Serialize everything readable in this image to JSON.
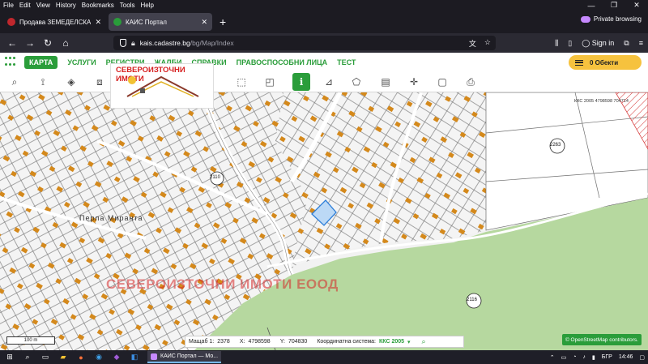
{
  "menubar": {
    "items": [
      "File",
      "Edit",
      "View",
      "History",
      "Bookmarks",
      "Tools",
      "Help"
    ]
  },
  "tabs": [
    {
      "label": "Продава ЗЕМЕДЕЛСКА ЗЕМЯ :",
      "close": "✕"
    },
    {
      "label": "КАИС Портал",
      "close": "✕"
    }
  ],
  "new_tab": "+",
  "private_browsing": "Private browsing",
  "navbar": {
    "url_host": "kais.cadastre.bg",
    "url_path": "/bg/Map/Index",
    "sign_in": "Sign in"
  },
  "site_nav": {
    "items": [
      "КАРТА",
      "УСЛУГИ",
      "РЕГИСТРИ",
      "ЖАЛБИ",
      "СПРАВКИ",
      "ПРАВОСПОСОБНИ ЛИЦА",
      "ТЕСТ"
    ],
    "objects_button": "0 Обекти"
  },
  "map": {
    "logo_text": "СЕВЕРОИЗТОЧНИ ИМОТИ",
    "watermark": "СЕВЕРОИЗТОЧНИ ИМОТИ ЕООД",
    "place_name": "Перла Миранта",
    "corner_label": "ККС 2005  4798598  704714",
    "circle_labels": [
      "2110",
      "2263",
      "2116"
    ]
  },
  "status": {
    "scale_label": "Мащаб 1:",
    "scale_value": "2378",
    "x_label": "X:",
    "x_value": "4798598",
    "y_label": "Y:",
    "y_value": "704830",
    "system_label": "Координатна система:",
    "system_value": "ККС 2005"
  },
  "scalebar": "100 m",
  "osm_attribution": "© OpenStreetMap  contributors.",
  "taskbar": {
    "active_window": "КАИС Портал — Мо...",
    "language": "БГР",
    "time": "14:46"
  }
}
